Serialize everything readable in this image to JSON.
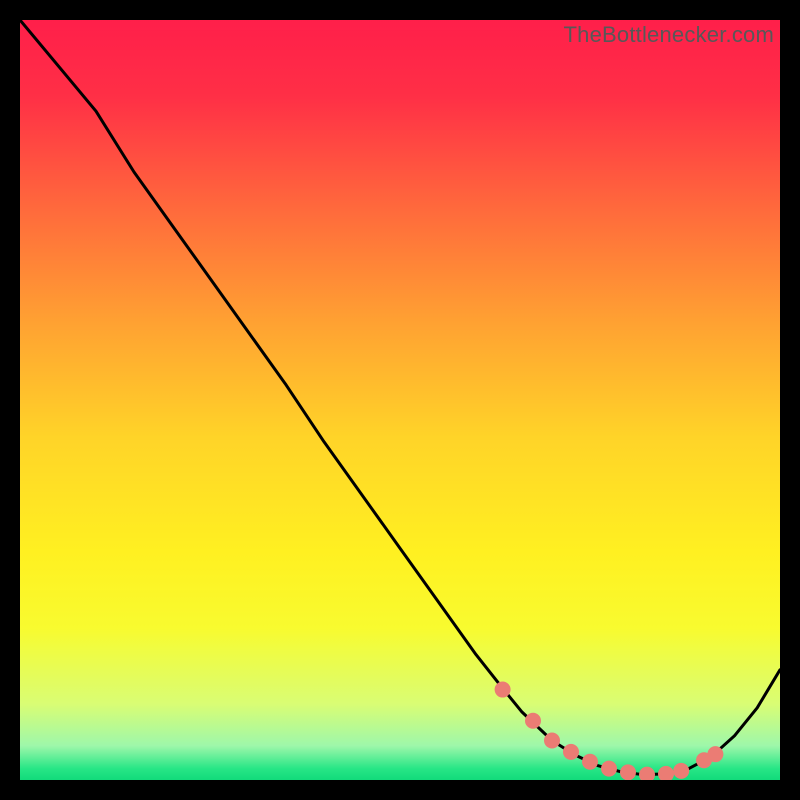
{
  "watermark": "TheBottlenecker.com",
  "chart_data": {
    "type": "line",
    "title": "",
    "xlabel": "",
    "ylabel": "",
    "xlim": [
      0,
      100
    ],
    "ylim": [
      0,
      100
    ],
    "grid": false,
    "series": [
      {
        "name": "curve",
        "x": [
          0,
          5,
          10,
          15,
          20,
          25,
          30,
          35,
          40,
          45,
          50,
          55,
          60,
          63,
          66,
          70,
          73,
          76,
          79,
          82,
          85,
          88,
          91,
          94,
          97,
          100
        ],
        "y": [
          100,
          94,
          88,
          80,
          73,
          66,
          59,
          52,
          44.5,
          37.5,
          30.5,
          23.5,
          16.5,
          12.7,
          9,
          5.2,
          3.3,
          1.9,
          1.1,
          0.7,
          0.8,
          1.5,
          3.1,
          5.8,
          9.5,
          14.5
        ]
      }
    ],
    "markers": {
      "name": "highlight-points",
      "color": "#eb7c74",
      "x": [
        63.5,
        67.5,
        70.0,
        72.5,
        75.0,
        77.5,
        80.0,
        82.5,
        85.0,
        87.0,
        90.0,
        91.5
      ],
      "y": [
        11.9,
        7.8,
        5.2,
        3.7,
        2.4,
        1.5,
        1.0,
        0.7,
        0.8,
        1.2,
        2.6,
        3.4
      ]
    },
    "gradient_stops": [
      {
        "offset": 0.0,
        "color": "#ff1f4a"
      },
      {
        "offset": 0.1,
        "color": "#ff2f46"
      },
      {
        "offset": 0.25,
        "color": "#ff6a3c"
      },
      {
        "offset": 0.4,
        "color": "#ffa232"
      },
      {
        "offset": 0.55,
        "color": "#ffd428"
      },
      {
        "offset": 0.7,
        "color": "#fff021"
      },
      {
        "offset": 0.8,
        "color": "#f8fb2f"
      },
      {
        "offset": 0.9,
        "color": "#d9fd74"
      },
      {
        "offset": 0.955,
        "color": "#9ef7aa"
      },
      {
        "offset": 0.985,
        "color": "#27e686"
      },
      {
        "offset": 1.0,
        "color": "#12db7b"
      }
    ]
  }
}
